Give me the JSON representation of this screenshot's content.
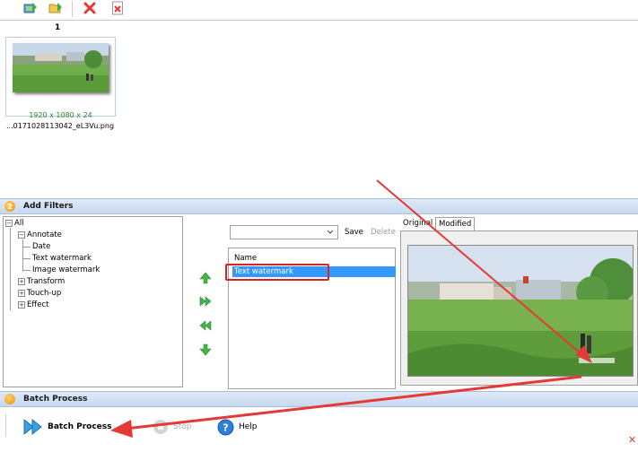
{
  "thumbnail": {
    "index": "1",
    "dimensions": "1920 x 1080 x 24",
    "filename": "...0171028113042_eL3Vu.png"
  },
  "add_filters": {
    "badge": "2",
    "title": "Add Filters",
    "tree": {
      "root": "All",
      "annotate": "Annotate",
      "date": "Date",
      "text_watermark": "Text watermark",
      "image_watermark": "Image watermark",
      "transform": "Transform",
      "touch_up": "Touch-up",
      "effect": "Effect"
    },
    "preset": {
      "value": "",
      "save": "Save",
      "delete": "Delete"
    },
    "list": {
      "header": "Name",
      "rows": [
        "Text watermark"
      ]
    },
    "tabs": {
      "original": "Original",
      "modified": "Modified"
    }
  },
  "batch_process": {
    "title": "Batch Process",
    "run": "Batch Process",
    "stop": "Stop",
    "help": "Help"
  },
  "colors": {
    "accent_red": "#e02020",
    "selection_blue": "#3399ff",
    "arrow_green": "#46b346"
  }
}
